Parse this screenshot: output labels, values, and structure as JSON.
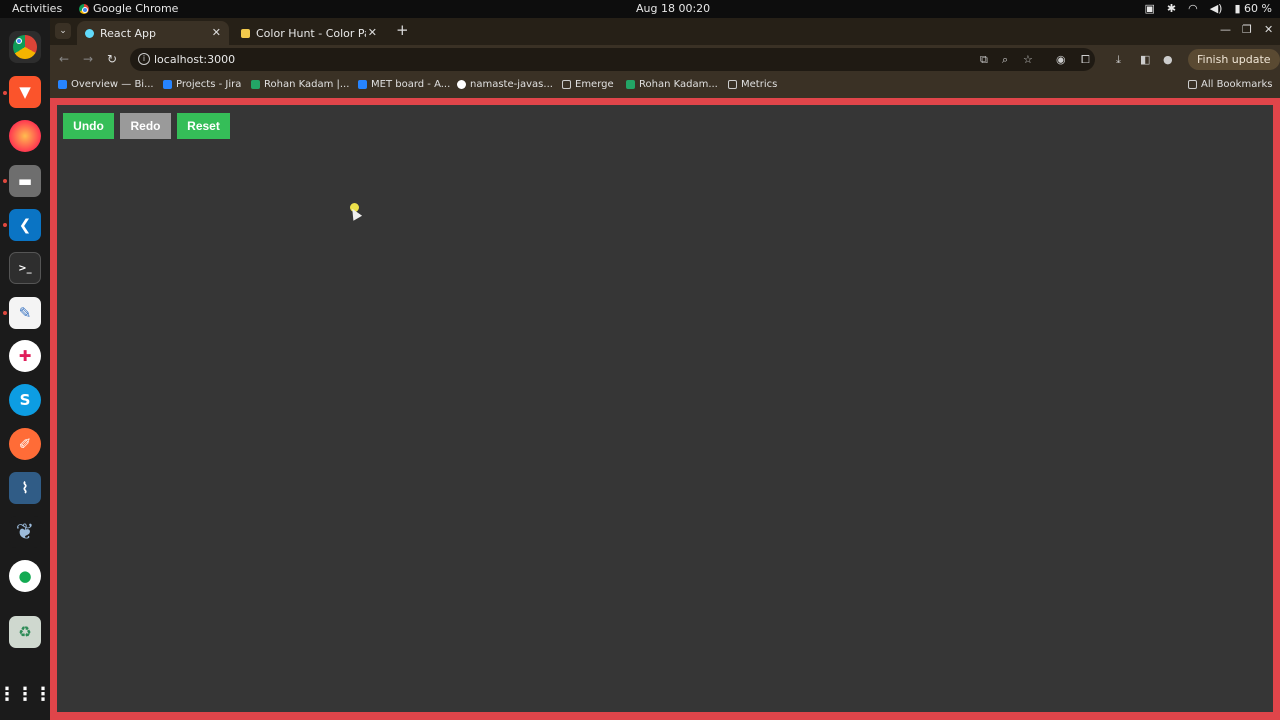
{
  "system": {
    "activities": "Activities",
    "app_name": "Google Chrome",
    "clock": "Aug 18  00:20",
    "battery": "60 %"
  },
  "dock": {
    "items": [
      "chrome",
      "brave",
      "firefox",
      "files",
      "vscode",
      "terminal",
      "text-editor",
      "slack",
      "skype",
      "postman",
      "mysql-workbench",
      "pgadmin",
      "mongodb-compass",
      "trash",
      "show-apps"
    ]
  },
  "browser": {
    "tabs": [
      {
        "label": "React App",
        "active": true
      },
      {
        "label": "Color Hunt - Color Palett",
        "active": false
      }
    ],
    "url": "localhost:3000",
    "finish_update": "Finish update",
    "bookmarks": [
      "Overview — Bi...",
      "Projects - Jira",
      "Rohan Kadam |...",
      "MET board - A...",
      "namaste-javas...",
      "Emerge",
      "Rohan Kadam...",
      "Metrics"
    ],
    "all_bookmarks": "All Bookmarks"
  },
  "app": {
    "undo_label": "Undo",
    "redo_label": "Redo",
    "reset_label": "Reset",
    "colors": {
      "border": "#e0454a",
      "canvas": "#363636",
      "button_enabled": "#35be58",
      "button_disabled": "#9a9a9a",
      "dot": "#ece04a"
    }
  }
}
